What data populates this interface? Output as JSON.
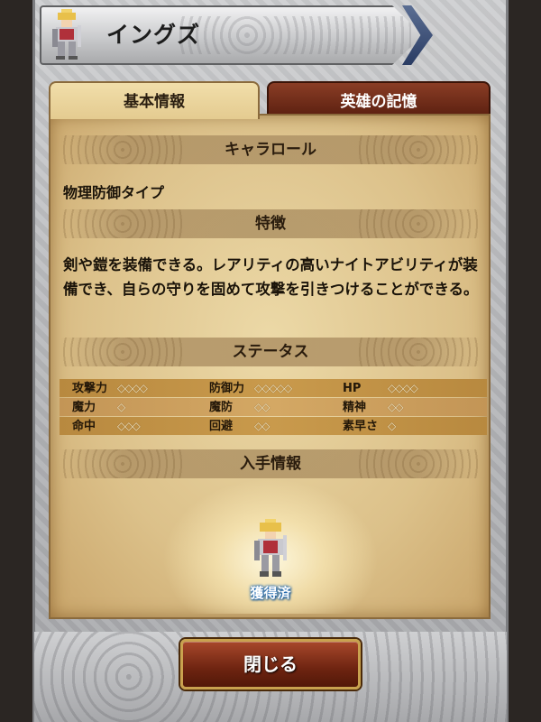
{
  "header": {
    "title": "イングズ"
  },
  "tabs": [
    {
      "label": "基本情報",
      "active": true
    },
    {
      "label": "英雄の記憶",
      "active": false
    }
  ],
  "sections": {
    "role_heading": "キャラロール",
    "role_value": "物理防御タイプ",
    "trait_heading": "特徴",
    "trait_text": "剣や鎧を装備できる。レアリティの高いナイトアビリティが装備でき、自らの守りを固めて攻撃を引きつけることができる。",
    "status_heading": "ステータス",
    "acquire_heading": "入手情報"
  },
  "stats": [
    {
      "label": "攻撃力",
      "rating": 4,
      "diamonds": "◇◇◇◇"
    },
    {
      "label": "防御力",
      "rating": 5,
      "diamonds": "◇◇◇◇◇"
    },
    {
      "label": "HP",
      "rating": 4,
      "diamonds": "◇◇◇◇"
    },
    {
      "label": "魔力",
      "rating": 1,
      "diamonds": "◇"
    },
    {
      "label": "魔防",
      "rating": 2,
      "diamonds": "◇◇"
    },
    {
      "label": "精神",
      "rating": 2,
      "diamonds": "◇◇"
    },
    {
      "label": "命中",
      "rating": 3,
      "diamonds": "◇◇◇"
    },
    {
      "label": "回避",
      "rating": 2,
      "diamonds": "◇◇"
    },
    {
      "label": "素早さ",
      "rating": 1,
      "diamonds": "◇"
    }
  ],
  "acquire": {
    "status": "獲得済"
  },
  "footer": {
    "close_label": "閉じる"
  },
  "colors": {
    "accent_red": "#7a2a14",
    "parchment": "#e4cb90",
    "acquired_blue": "#1a67b3"
  }
}
